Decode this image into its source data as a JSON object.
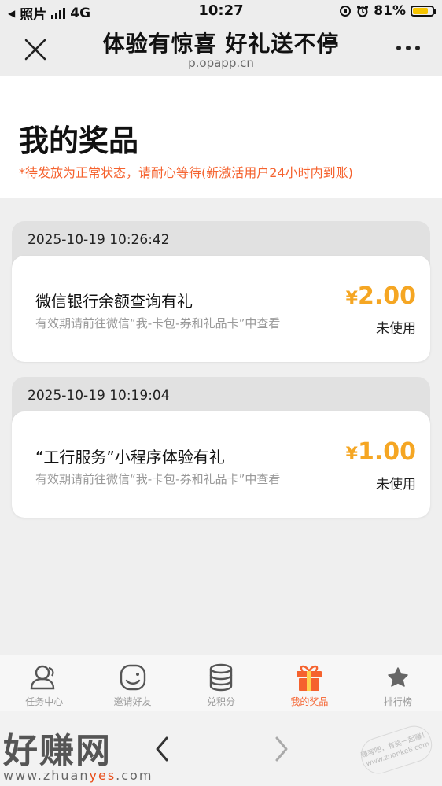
{
  "status_bar": {
    "back_app": "照片",
    "network": "4G",
    "time": "10:27",
    "battery": "81%"
  },
  "nav": {
    "title": "体验有惊喜 好礼送不停",
    "subtitle": "p.opapp.cn"
  },
  "header": {
    "title": "我的奖品",
    "note": "*待发放为正常状态，请耐心等待(新激活用户24小时内到账)"
  },
  "prizes": [
    {
      "date": "2025-10-19 10:26:42",
      "name": "微信银行余额查询有礼",
      "validity": "有效期请前往微信“我-卡包-券和礼品卡”中查看",
      "currency": "¥",
      "amount": "2.00",
      "status": "未使用"
    },
    {
      "date": "2025-10-19 10:19:04",
      "name": "“工行服务”小程序体验有礼",
      "validity": "有效期请前往微信“我-卡包-券和礼品卡”中查看",
      "currency": "¥",
      "amount": "1.00",
      "status": "未使用"
    }
  ],
  "tabs": [
    {
      "label": "任务中心",
      "icon": "user-group-icon",
      "active": false
    },
    {
      "label": "邀请好友",
      "icon": "smile-face-icon",
      "active": false
    },
    {
      "label": "兑积分",
      "icon": "coin-stack-icon",
      "active": false
    },
    {
      "label": "我的奖品",
      "icon": "gift-icon",
      "active": true
    },
    {
      "label": "排行榜",
      "icon": "star-icon",
      "active": false
    }
  ],
  "watermark": {
    "brand": "好赚网",
    "url_prefix": "www.zhuan",
    "url_highlight": "yes",
    "url_suffix": ".com",
    "stamp": "赚客吧，有奖一起赚！ www.zuanke8.com"
  },
  "colors": {
    "accent": "#f5622e",
    "amount": "#f5a623",
    "battery": "#f5c400"
  }
}
